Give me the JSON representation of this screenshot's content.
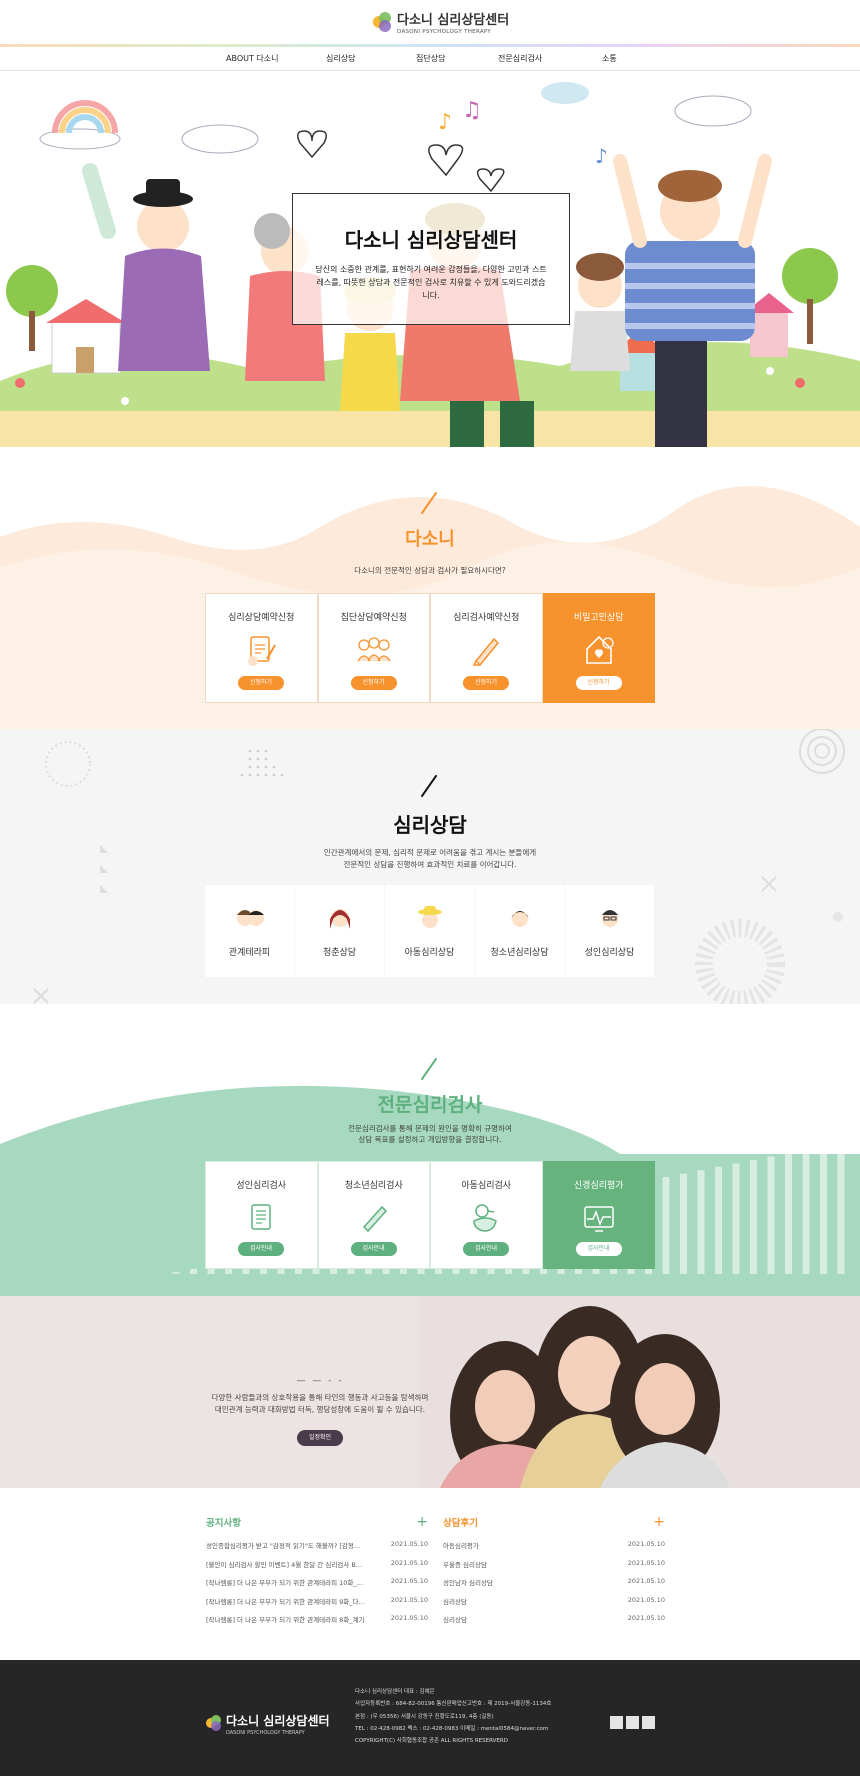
{
  "header": {
    "logo_main": "다소니 심리상담센터",
    "logo_sub": "DASONI PSYCHOLOGY THERAPY",
    "nav": [
      "ABOUT 다소니",
      "심리상담",
      "집단상담",
      "전문심리검사",
      "소통"
    ]
  },
  "hero": {
    "title": "다소니 심리상담센터",
    "desc": "당신의 소중한 관계를, 표현하기 여려운 감정들을, 다양한 고민과 스트레스를, 따뜻한 상담과 전문적인 검사로 치유할 수 있게 도와드리겠습니다."
  },
  "dasoni": {
    "title": "다소니",
    "subtitle": "다소니의 전문적인 상담과 검사가 필요하시다면?",
    "accent": "#f7922d",
    "cards": [
      {
        "title": "심리상담예약신청",
        "button": "신청하기",
        "icon": "clipboard-pen-icon"
      },
      {
        "title": "집단상담예약신청",
        "button": "신청하기",
        "icon": "group-people-icon"
      },
      {
        "title": "심리검사예약신청",
        "button": "신청하기",
        "icon": "pencil-icon"
      },
      {
        "title": "비밀고민상담",
        "button": "신청하기",
        "icon": "house-heart-icon"
      }
    ]
  },
  "counsel": {
    "title": "심리상담",
    "subtitle_line1": "인간관계에서의 문제, 심리적 문제로 어려움을 겪고 계시는 분들에게",
    "subtitle_line2": "전문적인 상담을 진행하여 효과적인 치료를 이어갑니다.",
    "items": [
      {
        "label": "관계테라피",
        "icon": "couple-icon"
      },
      {
        "label": "청춘상담",
        "icon": "young-woman-icon"
      },
      {
        "label": "아동심리상담",
        "icon": "child-icon"
      },
      {
        "label": "청소년심리상담",
        "icon": "teen-icon"
      },
      {
        "label": "성인심리상담",
        "icon": "adult-man-icon"
      }
    ]
  },
  "test": {
    "title": "전문심리검사",
    "subtitle_line1": "전문심리검사를 통해 문제의 원인을 명확히 규명하여",
    "subtitle_line2": "상담 목표를 설정하고 개입방향을 결정합니다.",
    "accent": "#5fb07f",
    "cards": [
      {
        "title": "성인심리검사",
        "button": "검사안내",
        "icon": "document-icon"
      },
      {
        "title": "청소년심리검사",
        "button": "검사안내",
        "icon": "pencil-icon"
      },
      {
        "title": "아동심리검사",
        "button": "검사안내",
        "icon": "duck-icon"
      },
      {
        "title": "신경심리평가",
        "button": "검사안내",
        "icon": "brain-monitor-icon"
      }
    ]
  },
  "group": {
    "dash": "— — - -",
    "desc_line1": "다양한 사람들과의 상호작용을 통해 타인의 행동과 사고등을 탐색하며",
    "desc_line2": "대인관계 능력과 대화방법 터득, 행당성장에 도움이 될 수 있습니다.",
    "button": "일정확인"
  },
  "notice": {
    "title": "공지사항",
    "rows": [
      {
        "title": "성인종합심리평가 받고 \"감정적 읽기\"도 해볼까? [감정다이어리]",
        "date": "2021.05.10"
      },
      {
        "title": "[불안이 심리검사 할인 이벤트] 4월 한달 간 심리검사 BEST 할인",
        "date": "2021.05.10"
      },
      {
        "title": "[작나렘롱] 더 나은 부부가 되기 위한 관계테라피 10화_마치며",
        "date": "2021.05.10"
      },
      {
        "title": "[작나렘롱] 더 나은 부부가 되기 위한 관계테라피 9화_다시 시작",
        "date": "2021.05.10"
      },
      {
        "title": "[작나렘롱] 더 나은 부부가 되기 위한 관계테라피 8화_계기",
        "date": "2021.05.10"
      }
    ]
  },
  "review": {
    "title": "상담후기",
    "rows": [
      {
        "title": "아동심리평가",
        "date": "2021.05.10"
      },
      {
        "title": "우울증 심리상담",
        "date": "2021.05.10"
      },
      {
        "title": "성인남자 심리상담",
        "date": "2021.05.10"
      },
      {
        "title": "심리상담",
        "date": "2021.05.10"
      },
      {
        "title": "심리상담",
        "date": "2021.05.10"
      }
    ]
  },
  "footer": {
    "lines": [
      "다소니 심리상담센터 대표 : 김예은",
      "사업자등록번호 : 684-82-00196 통신판매업신고번호 : 제 2019-서울강동-1134호",
      "본점 : (우 05356) 서울시 강동구 진황도로119, 4층 (길동)",
      "TEL : 02-428-0982 팩스 : 02-428-0983 이메일 : mental0584@naver.com",
      "COPYRIGHT(C) 사회협동조합 공존 ALL RIGHTS RESERVERD"
    ]
  }
}
